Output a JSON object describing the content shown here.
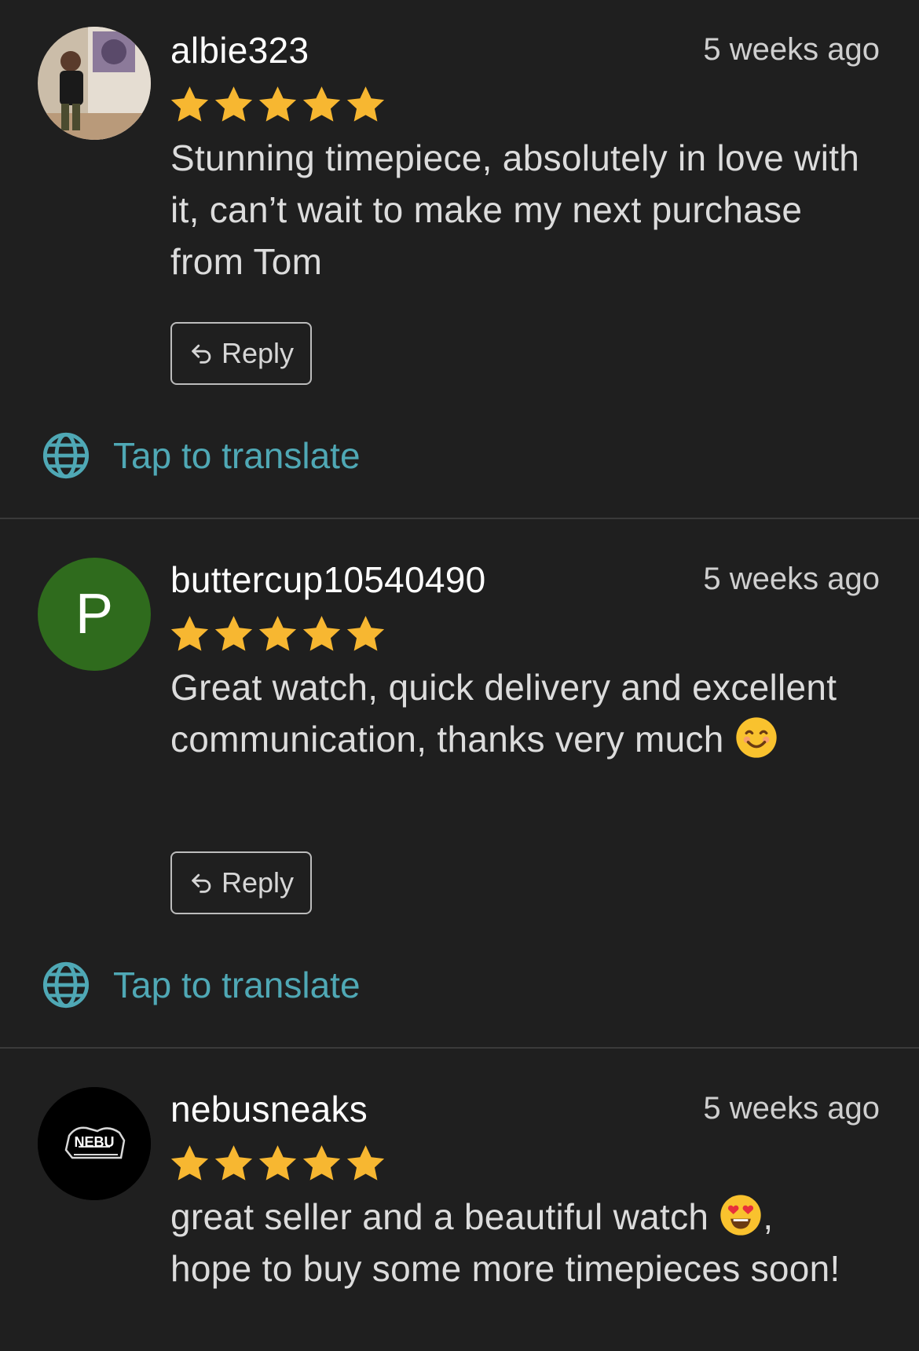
{
  "reviews": [
    {
      "username": "albie323",
      "time": "5 weeks ago",
      "rating": 5,
      "text": "Stunning timepiece, absolutely in love with it, can’t wait to make my next purchase from Tom",
      "avatar": "photo"
    },
    {
      "username": "buttercup10540490",
      "time": "5 weeks ago",
      "rating": 5,
      "text_before_emoji": "Great watch, quick delivery and excellent communication, thanks very much ",
      "emoji": "smiling-face-icon",
      "avatar_letter": "P"
    },
    {
      "username": "nebusneaks",
      "time": "5 weeks ago",
      "rating": 5,
      "text_before_emoji": "great seller and a beautiful watch ",
      "emoji": "heart-eyes-icon",
      "text_after_emoji": ", hope to buy some more timepieces soon!",
      "avatar_logo_text": "NEBU"
    }
  ],
  "reply_label": "Reply",
  "translate_label": "Tap to translate",
  "colors": {
    "background": "#1f1f1f",
    "star": "#f7b731",
    "translate": "#4fa8b5",
    "avatar_p": "#2f6b1d"
  }
}
